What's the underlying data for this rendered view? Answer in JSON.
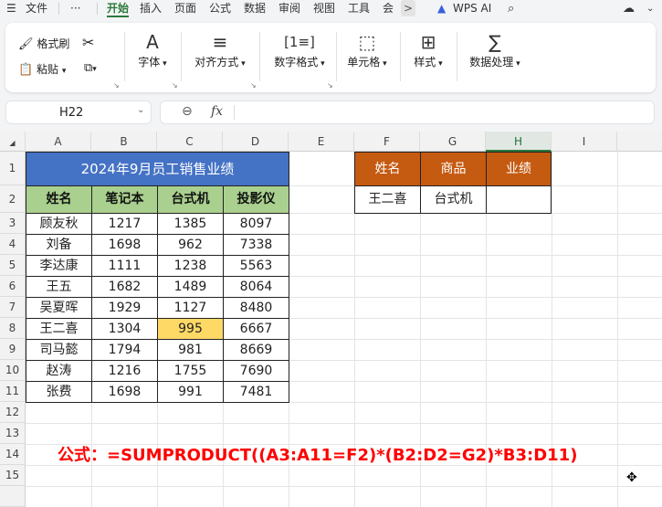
{
  "menubar": {
    "menu_icon": "menu-lines-icon",
    "file": "文件",
    "more": "···",
    "tabs": [
      "开始",
      "插入",
      "页面",
      "公式",
      "数据",
      "审阅",
      "视图",
      "工具",
      "会"
    ],
    "active_tab": "开始",
    "overflow_arrow": ">",
    "wps_ai": "WPS AI",
    "accent_color": "#2b7a3b"
  },
  "ribbon": {
    "format_painter": "格式刷",
    "paste": "粘贴",
    "font": "字体",
    "align": "对齐方式",
    "number_format": "数字格式",
    "cell": "单元格",
    "style": "样式",
    "data_process": "数据处理"
  },
  "formula_bar": {
    "name_box": "H22",
    "fx": "fx",
    "value": ""
  },
  "sheet": {
    "columns": [
      "A",
      "B",
      "C",
      "D",
      "E",
      "F",
      "G",
      "H",
      "I"
    ],
    "selected_column": "H",
    "rows": [
      "1",
      "2",
      "3",
      "4",
      "5",
      "6",
      "7",
      "8",
      "9",
      "10",
      "11",
      "12",
      "13",
      "14",
      "15"
    ],
    "title": "2024年9月员工销售业绩",
    "headers": [
      "姓名",
      "笔记本",
      "台式机",
      "投影仪"
    ],
    "data": [
      [
        "顾友秋",
        "1217",
        "1385",
        "8097"
      ],
      [
        "刘备",
        "1698",
        "962",
        "7338"
      ],
      [
        "李达康",
        "1111",
        "1238",
        "5563"
      ],
      [
        "王五",
        "1682",
        "1489",
        "8064"
      ],
      [
        "吴夏晖",
        "1929",
        "1127",
        "8480"
      ],
      [
        "王二喜",
        "1304",
        "995",
        "6667"
      ],
      [
        "司马懿",
        "1794",
        "981",
        "8669"
      ],
      [
        "赵涛",
        "1216",
        "1755",
        "7690"
      ],
      [
        "张费",
        "1698",
        "991",
        "7481"
      ]
    ],
    "lookup_headers": [
      "姓名",
      "商品",
      "业绩"
    ],
    "lookup_values": [
      "王二喜",
      "台式机",
      ""
    ],
    "formula_note": "公式：=SUMPRODUCT((A3:A11=F2)*(B2:D2=G2)*B3:D11)",
    "colors": {
      "title_bg": "#4472c4",
      "header_green": "#a9d08e",
      "header_orange": "#c55a11",
      "highlight_yellow": "#ffd966",
      "note_red": "#ff0000"
    }
  }
}
